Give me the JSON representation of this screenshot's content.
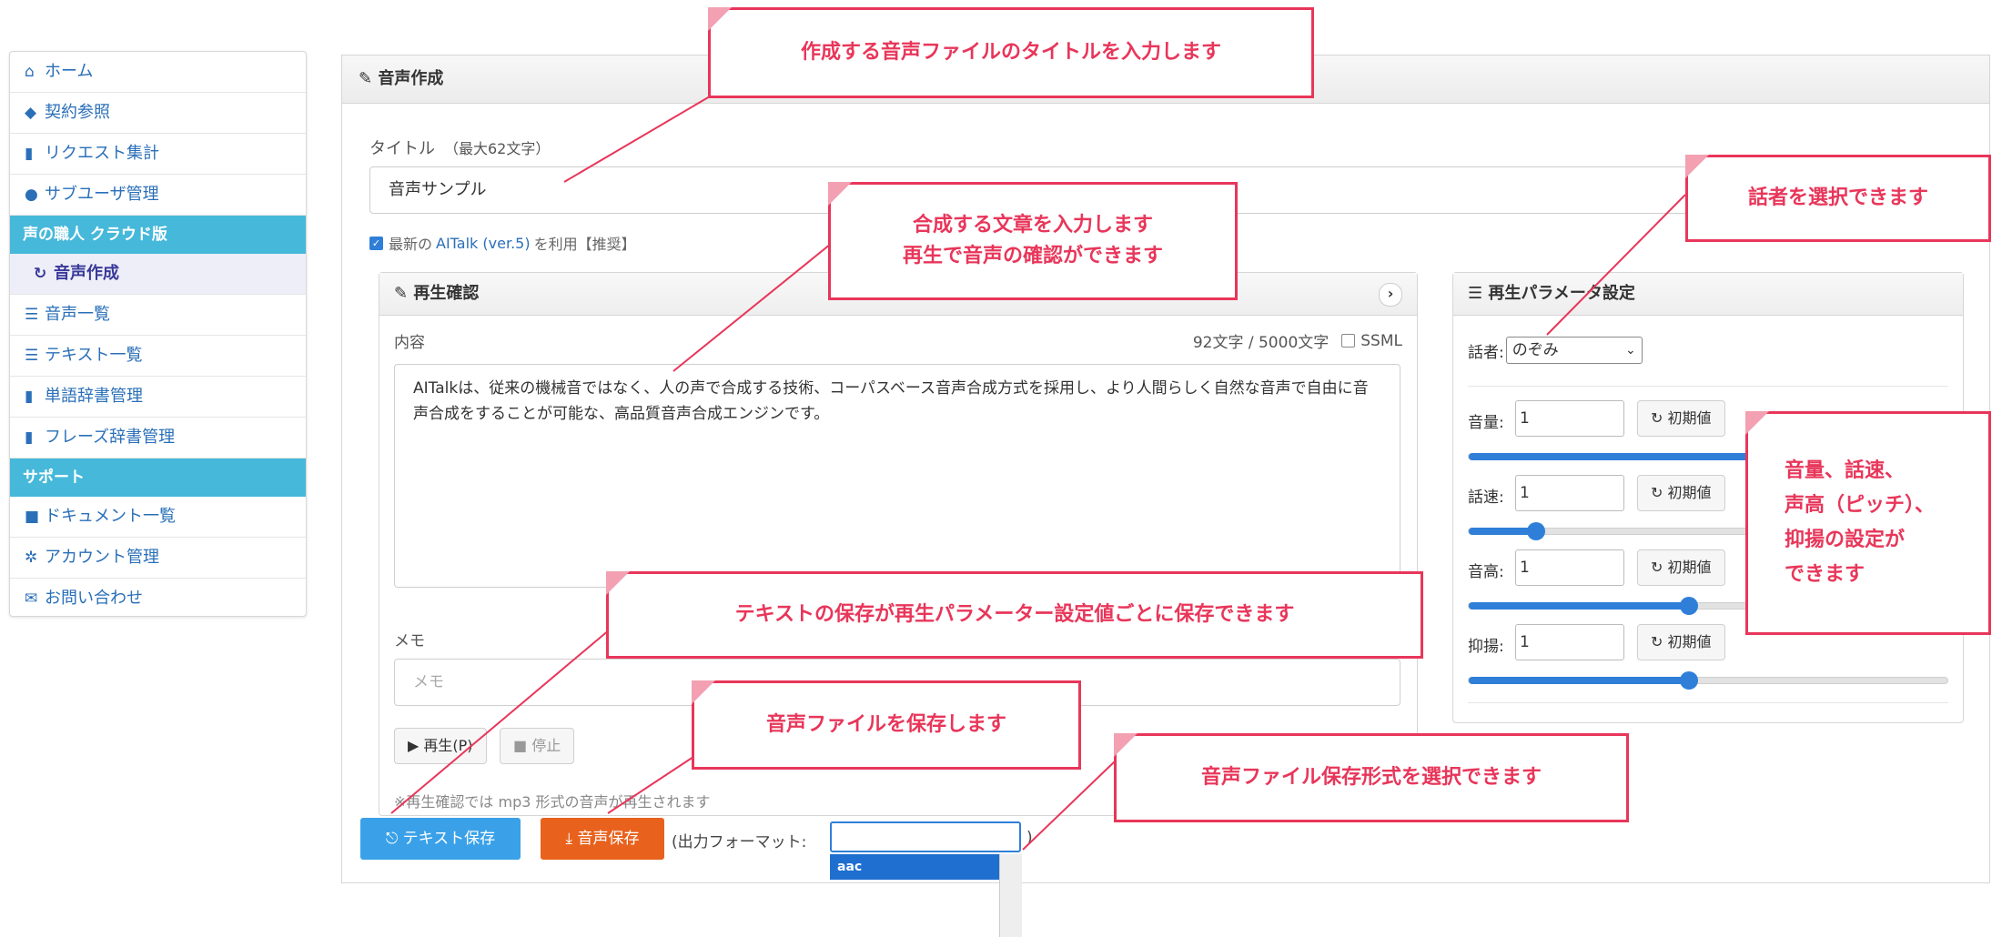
{
  "sidebar": {
    "items": [
      {
        "icon": "home-icon",
        "glyph": "⌂",
        "label": "ホーム"
      },
      {
        "icon": "tag-icon",
        "glyph": "◆",
        "label": "契約参照"
      },
      {
        "icon": "bar-chart-icon",
        "glyph": "▮",
        "label": "リクエスト集計"
      },
      {
        "icon": "user-icon",
        "glyph": "●",
        "label": "サブユーザ管理"
      }
    ],
    "section_voice": "声の職人 クラウド版",
    "voice_items": [
      {
        "icon": "refresh-icon",
        "glyph": "↻",
        "label": "音声作成",
        "active": true
      },
      {
        "icon": "list-icon",
        "glyph": "☰",
        "label": "音声一覧"
      },
      {
        "icon": "list-icon",
        "glyph": "☰",
        "label": "テキスト一覧"
      },
      {
        "icon": "book-icon",
        "glyph": "▮",
        "label": "単語辞書管理"
      },
      {
        "icon": "book-icon",
        "glyph": "▮",
        "label": "フレーズ辞書管理"
      }
    ],
    "section_support": "サポート",
    "support_items": [
      {
        "icon": "briefcase-icon",
        "glyph": "■",
        "label": "ドキュメント一覧"
      },
      {
        "icon": "gear-icon",
        "glyph": "✲",
        "label": "アカウント管理"
      },
      {
        "icon": "mail-icon",
        "glyph": "✉",
        "label": "お問い合わせ"
      }
    ]
  },
  "panel": {
    "title": "音声作成",
    "title_label": "タイトル",
    "title_hint": "（最大62文字）",
    "title_value": "音声サンプル",
    "latest_prefix": "最新の",
    "latest_link": "AITalk (ver.5)",
    "latest_suffix": "を利用【推奨】"
  },
  "playback": {
    "title": "再生確認",
    "content_label": "内容",
    "char_count": "92文字 / 5000文字",
    "ssml_label": "SSML",
    "text": "AITalkは、従来の機械音ではなく、人の声で合成する技術、コーパスベース音声合成方式を採用し、より人間らしく自然な音声で自由に音声合成をすることが可能な、高品質音声合成エンジンです。",
    "memo_label": "メモ",
    "memo_placeholder": "メモ",
    "play_label": "▶ 再生(P)",
    "stop_label": "■ 停止",
    "note": "※再生確認では mp3 形式の音声が再生されます"
  },
  "params": {
    "title": "再生パラメータ設定",
    "speaker_label": "話者:",
    "speaker_value": "のぞみ",
    "reset_label": "初期値",
    "rows": [
      {
        "label": "音量:",
        "value": "1",
        "level": 0.69
      },
      {
        "label": "話速:",
        "value": "1",
        "level": 0.14
      },
      {
        "label": "音高:",
        "value": "1",
        "level": 0.46
      },
      {
        "label": "抑揚:",
        "value": "1",
        "level": 0.46
      }
    ]
  },
  "bottom": {
    "save_text": "テキスト保存",
    "save_audio": "音声保存",
    "format_label": "(出力フォーマット:",
    "format_close": ")",
    "format_option": "aac"
  },
  "callouts": {
    "title_input": "作成する音声ファイルのタイトルを入力します",
    "sentence_1": "合成する文章を入力します",
    "sentence_2": "再生で音声の確認ができます",
    "speaker": "話者を選択できます",
    "params_1": "音量、話速、",
    "params_2": "声高（ピッチ）、",
    "params_3": "抑揚の設定が",
    "params_4": "できます",
    "text_save": "テキストの保存が再生パラメーター設定値ごとに保存できます",
    "audio_save": "音声ファイルを保存します",
    "format": "音声ファイル保存形式を選択できます"
  },
  "colors": {
    "accent": "#e8365a",
    "section_header": "#46b8d9",
    "primary_blue": "#3aa1e8",
    "audio_orange": "#e8621e",
    "slider_blue": "#2f7fd8"
  }
}
